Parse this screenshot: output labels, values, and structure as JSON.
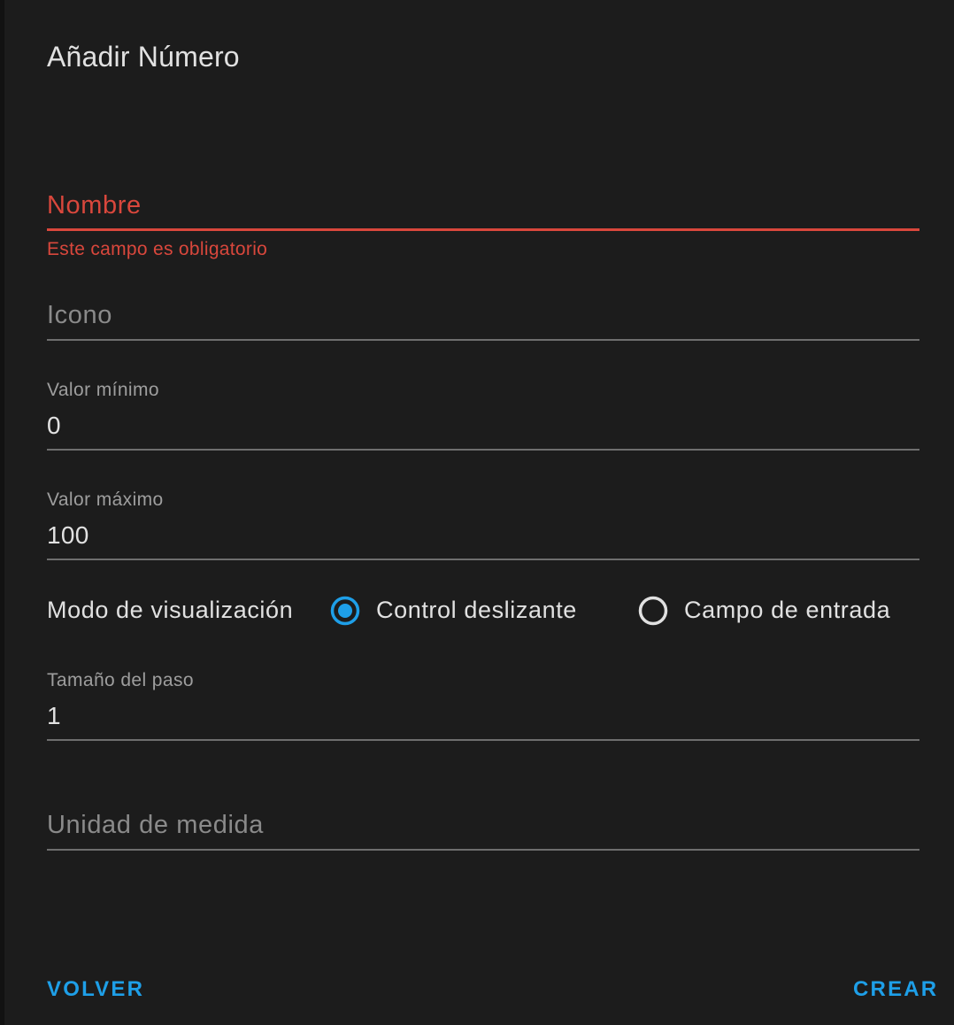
{
  "dialog": {
    "title": "Añadir Número"
  },
  "fields": {
    "name": {
      "placeholder": "Nombre",
      "error": "Este campo es obligatorio"
    },
    "icon": {
      "placeholder": "Icono"
    },
    "min": {
      "label": "Valor mínimo",
      "value": "0"
    },
    "max": {
      "label": "Valor máximo",
      "value": "100"
    },
    "mode": {
      "label": "Modo de visualización",
      "options": [
        {
          "label": "Control deslizante",
          "selected": true
        },
        {
          "label": "Campo de entrada",
          "selected": false
        }
      ]
    },
    "step": {
      "label": "Tamaño del paso",
      "value": "1"
    },
    "unit": {
      "placeholder": "Unidad de medida"
    }
  },
  "actions": {
    "back_label": "VOLVER",
    "create_label": "CREAR"
  },
  "colors": {
    "accent": "#1e9fe8",
    "error": "#d9473c",
    "background": "#1c1c1c",
    "text": "#e1e1e1"
  }
}
